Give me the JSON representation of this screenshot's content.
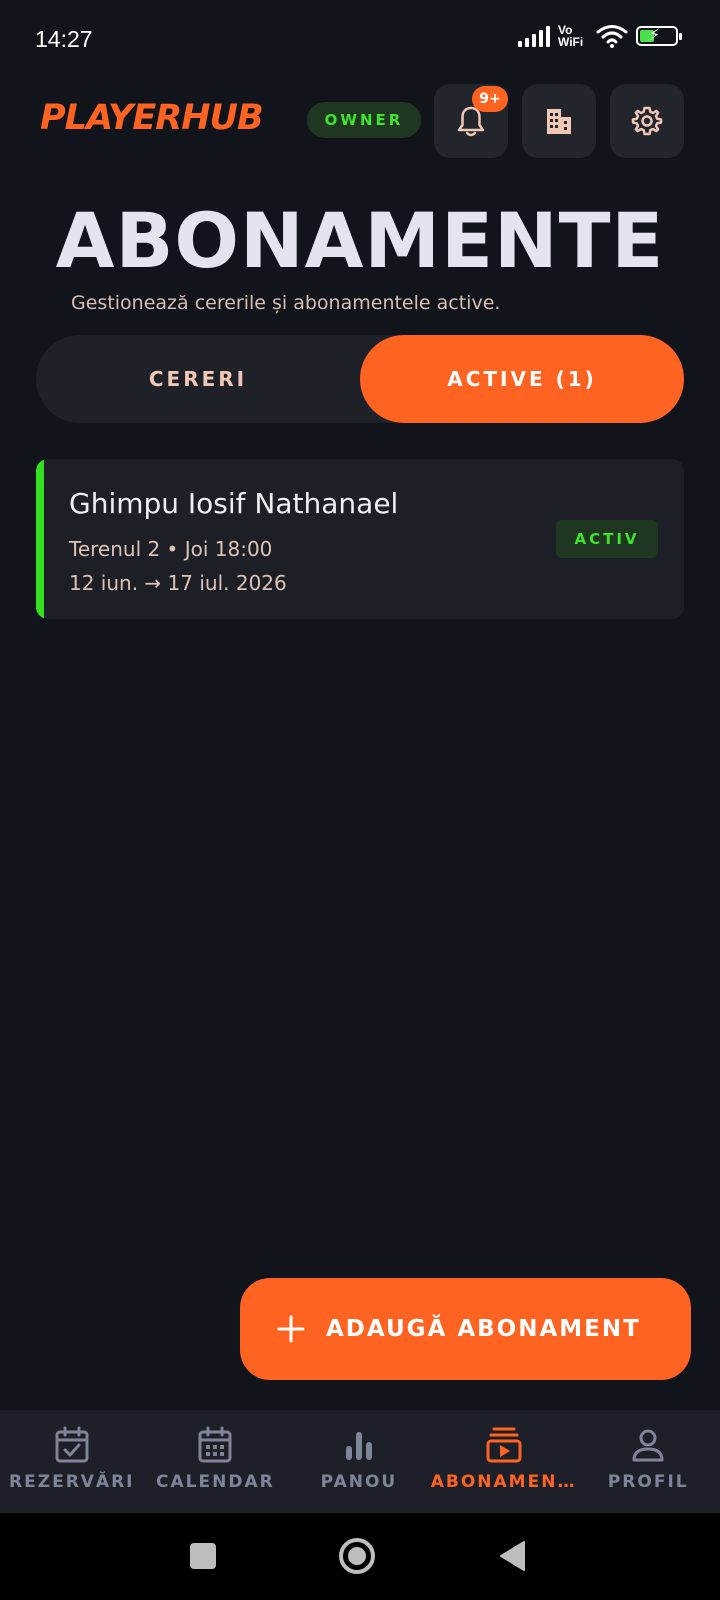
{
  "status_bar": {
    "time": "14:27",
    "vowifi_top": "Vo",
    "vowifi_bottom": "WiFi",
    "icons": [
      "signal-icon",
      "wifi-icon",
      "battery-charging-icon"
    ]
  },
  "header": {
    "brand": "PLAYERHUB",
    "role_badge": "OWNER",
    "notification_count": "9+",
    "icons": [
      "bell-icon",
      "building-icon",
      "gear-icon"
    ]
  },
  "page": {
    "title": "ABONAMENTE",
    "subtitle": "Gestionează cererile și abonamentele active."
  },
  "tabs": {
    "requests_label": "CERERI",
    "active_label": "ACTIVE (1)",
    "selected": "ACTIVE (1)"
  },
  "subscriptions": [
    {
      "name": "Ghimpu Iosif Nathanael",
      "slot": "Terenul 2 • Joi 18:00",
      "dates": "12 iun. → 17 iul. 2026",
      "status": "ACTIV"
    }
  ],
  "fab": {
    "label": "ADAUGĂ ABONAMENT",
    "icon": "plus-icon"
  },
  "bottom_nav": {
    "items": [
      {
        "label": "REZERVĂRI",
        "icon": "calendar-check-icon"
      },
      {
        "label": "CALENDAR",
        "icon": "calendar-grid-icon"
      },
      {
        "label": "PANOU",
        "icon": "bar-chart-icon"
      },
      {
        "label": "ABONAMEN…",
        "icon": "subscriptions-icon"
      },
      {
        "label": "PROFIL",
        "icon": "person-icon"
      }
    ],
    "active": "ABONAMEN…"
  },
  "colors": {
    "accent": "#ff6322",
    "success": "#3fe42d",
    "background": "#12141b",
    "card": "#1d1f26"
  }
}
